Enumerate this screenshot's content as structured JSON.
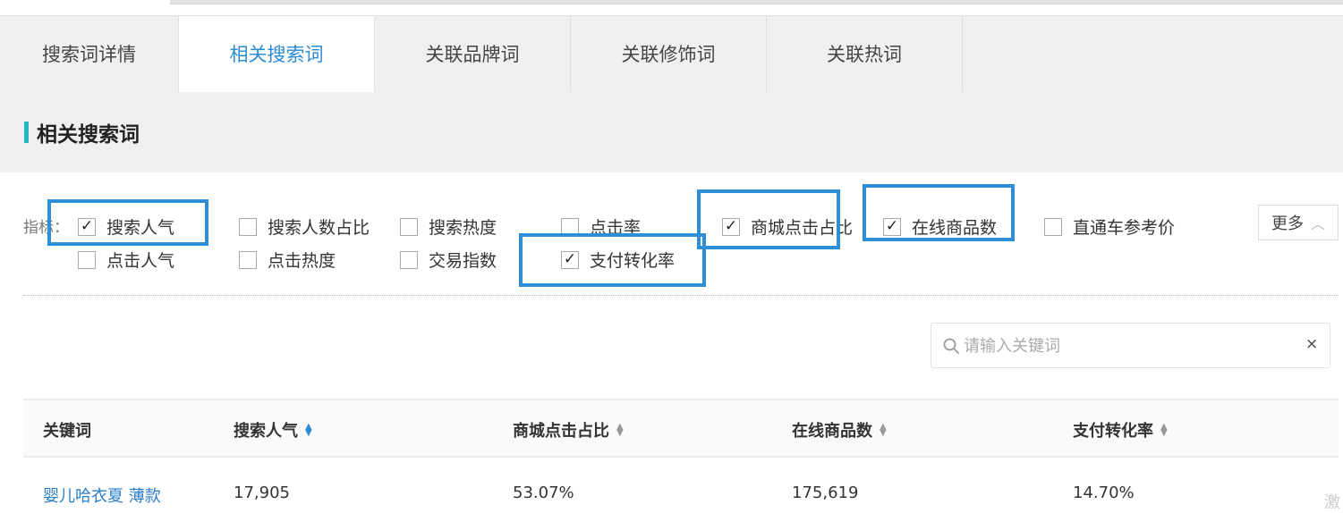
{
  "tabs": [
    {
      "label": "搜索词详情",
      "active": false
    },
    {
      "label": "相关搜索词",
      "active": true
    },
    {
      "label": "关联品牌词",
      "active": false
    },
    {
      "label": "关联修饰词",
      "active": false
    },
    {
      "label": "关联热词",
      "active": false
    }
  ],
  "section": {
    "title": "相关搜索词"
  },
  "metrics": {
    "label": "指标：",
    "row1": [
      {
        "label": "搜索人气",
        "checked": true
      },
      {
        "label": "搜索人数占比",
        "checked": false
      },
      {
        "label": "搜索热度",
        "checked": false
      },
      {
        "label": "点击率",
        "checked": false
      },
      {
        "label": "商城点击占比",
        "checked": true
      },
      {
        "label": "在线商品数",
        "checked": true
      },
      {
        "label": "直通车参考价",
        "checked": false
      }
    ],
    "row2": [
      {
        "label": "点击人气",
        "checked": false
      },
      {
        "label": "点击热度",
        "checked": false
      },
      {
        "label": "交易指数",
        "checked": false
      },
      {
        "label": "支付转化率",
        "checked": true
      }
    ],
    "more_label": "更多"
  },
  "search": {
    "placeholder": "请输入关键词",
    "value": ""
  },
  "table": {
    "columns": [
      "关键词",
      "搜索人气",
      "商城点击占比",
      "在线商品数",
      "支付转化率"
    ],
    "rows": [
      [
        "婴儿哈衣夏 薄款",
        "17,905",
        "53.07%",
        "175,619",
        "14.70%"
      ]
    ]
  },
  "corner_text": "激",
  "colors": {
    "accent": "#2b8cd4",
    "highlight": "#2e8fd8",
    "section_bar": "#25b7c0"
  }
}
